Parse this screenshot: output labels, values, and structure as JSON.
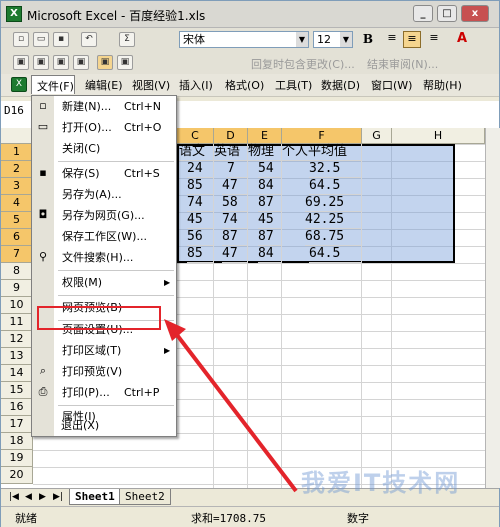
{
  "window": {
    "title": "Microsoft Excel - 百度经验1.xls",
    "app_icon_glyph": "X",
    "min_glyph": "_",
    "max_glyph": "□",
    "close_glyph": "x"
  },
  "toolbar": {
    "font_name": "宋体",
    "font_size": "12",
    "bold": "B",
    "reply_text": "回复时包含更改(C)...",
    "end_review_text": "结束审阅(N)..."
  },
  "menubar": {
    "items": [
      "文件(F)",
      "编辑(E)",
      "视图(V)",
      "插入(I)",
      "格式(O)",
      "工具(T)",
      "数据(D)",
      "窗口(W)",
      "帮助(H)"
    ]
  },
  "namebox": "D16",
  "columns": [
    "C",
    "D",
    "E",
    "F",
    "G",
    "H"
  ],
  "rows": [
    "1",
    "2",
    "3",
    "4",
    "5",
    "6",
    "7",
    "8",
    "9",
    "10",
    "11",
    "12",
    "13",
    "14",
    "15",
    "16",
    "17",
    "18",
    "19",
    "20",
    "21",
    "22"
  ],
  "table": {
    "header": [
      "语文",
      "英语",
      "物理",
      "个人平均值"
    ],
    "rows": [
      [
        "24",
        "7",
        "54",
        "32.5"
      ],
      [
        "85",
        "47",
        "84",
        "64.5"
      ],
      [
        "74",
        "58",
        "87",
        "69.25"
      ],
      [
        "45",
        "74",
        "45",
        "42.25"
      ],
      [
        "56",
        "87",
        "87",
        "68.75"
      ],
      [
        "85",
        "47",
        "84",
        "64.5"
      ]
    ]
  },
  "file_menu": {
    "items": [
      {
        "label": "新建(N)...",
        "shortcut": "Ctrl+N",
        "icon": "new-doc-icon",
        "glyph": "▫"
      },
      {
        "label": "打开(O)...",
        "shortcut": "Ctrl+O",
        "icon": "open-folder-icon",
        "glyph": "▭"
      },
      {
        "label": "关闭(C)",
        "shortcut": "",
        "icon": "",
        "glyph": ""
      },
      {
        "label": "保存(S)",
        "shortcut": "Ctrl+S",
        "icon": "save-icon",
        "glyph": "▪"
      },
      {
        "label": "另存为(A)...",
        "shortcut": "",
        "icon": "",
        "glyph": ""
      },
      {
        "label": "另存为网页(G)...",
        "shortcut": "",
        "icon": "web-save-icon",
        "glyph": "◘"
      },
      {
        "label": "保存工作区(W)...",
        "shortcut": "",
        "icon": "",
        "glyph": ""
      },
      {
        "label": "文件搜索(H)...",
        "shortcut": "",
        "icon": "file-search-icon",
        "glyph": "⚲"
      },
      {
        "label": "权限(M)",
        "shortcut": "",
        "icon": "",
        "glyph": "",
        "submenu": true
      },
      {
        "label": "网页预览(B)",
        "shortcut": "",
        "icon": "",
        "glyph": ""
      },
      {
        "label": "页面设置(U)...",
        "shortcut": "",
        "icon": "",
        "glyph": ""
      },
      {
        "label": "打印区域(T)",
        "shortcut": "",
        "icon": "",
        "glyph": "",
        "submenu": true
      },
      {
        "label": "打印预览(V)",
        "shortcut": "",
        "icon": "print-preview-icon",
        "glyph": "⌕"
      },
      {
        "label": "打印(P)...",
        "shortcut": "Ctrl+P",
        "icon": "print-icon",
        "glyph": "⎙"
      },
      {
        "label": "属性(I)",
        "shortcut": "",
        "icon": "",
        "glyph": ""
      },
      {
        "label": "退出(X)",
        "shortcut": "",
        "icon": "",
        "glyph": ""
      }
    ]
  },
  "sheets": [
    "Sheet1",
    "Sheet2"
  ],
  "status": {
    "ready": "就绪",
    "sum": "求和=1708.75",
    "mode": "数字"
  },
  "watermark": "我爱IT技术网",
  "colors": {
    "selection": "#7aa0da",
    "highlight_box": "#e3242b",
    "arrow": "#e3242b",
    "selected_header": "#f5c66a"
  }
}
